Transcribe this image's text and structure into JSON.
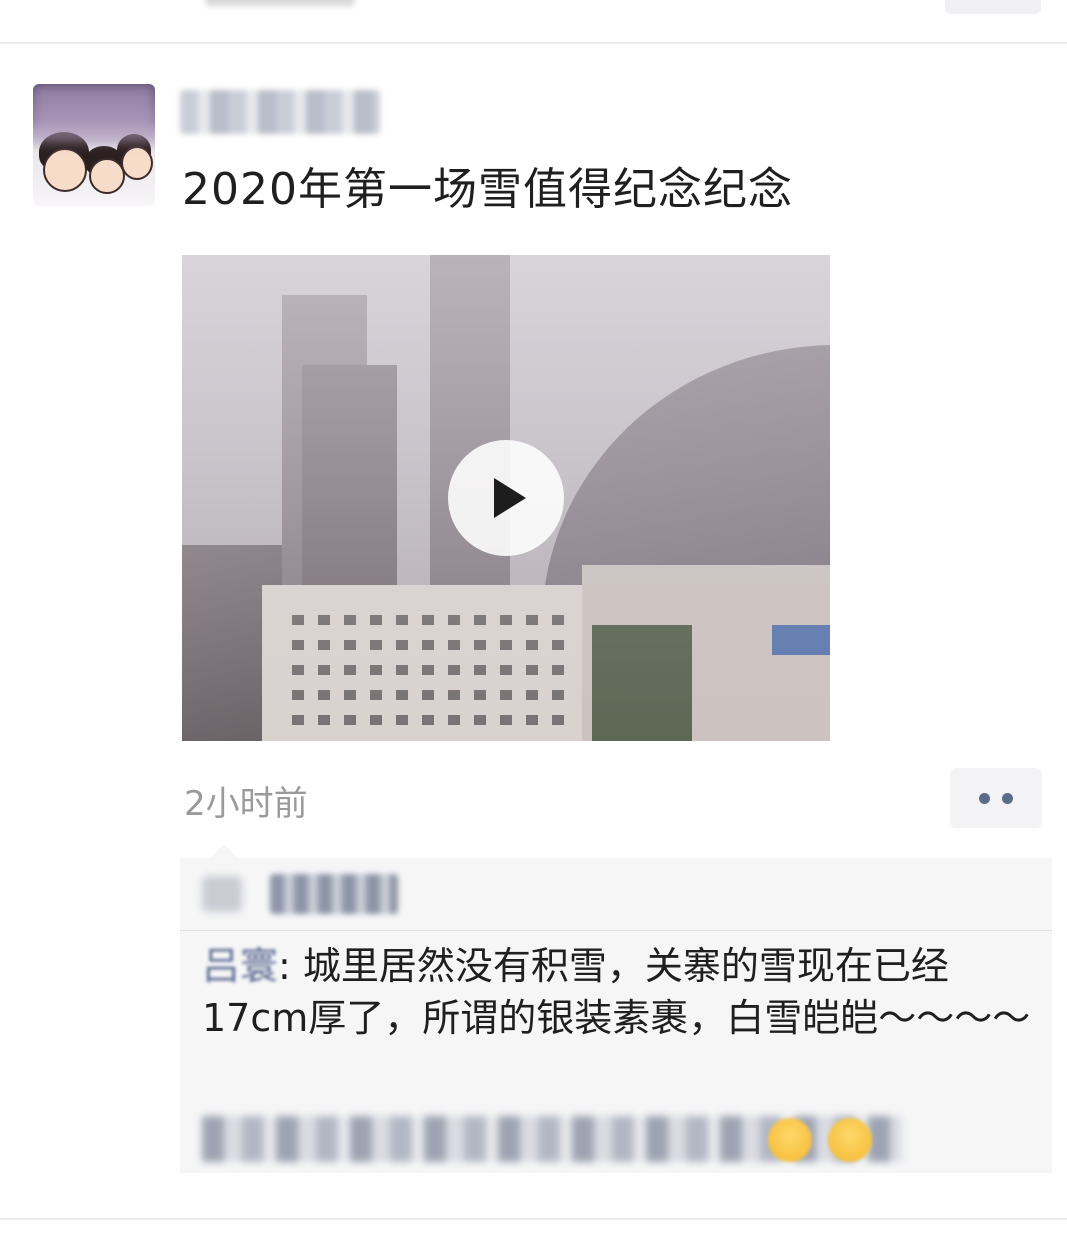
{
  "post": {
    "text": "2020年第一场雪值得纪念纪念",
    "timestamp": "2小时前",
    "media": {
      "type": "video",
      "play_icon": "play-icon"
    }
  },
  "actions": {
    "more_icon": "more-dots-icon"
  },
  "comments": [
    {
      "author": "吕寰",
      "separator": ": ",
      "text": "城里居然没有积雪，关寨的雪现在已经17cm厚了，所谓的银装素裹，白雪皑皑～～～～"
    }
  ],
  "colors": {
    "link_blue": "#5b6b92",
    "timestamp_gray": "#9a9a9a",
    "comment_bg": "#f6f6f7"
  }
}
